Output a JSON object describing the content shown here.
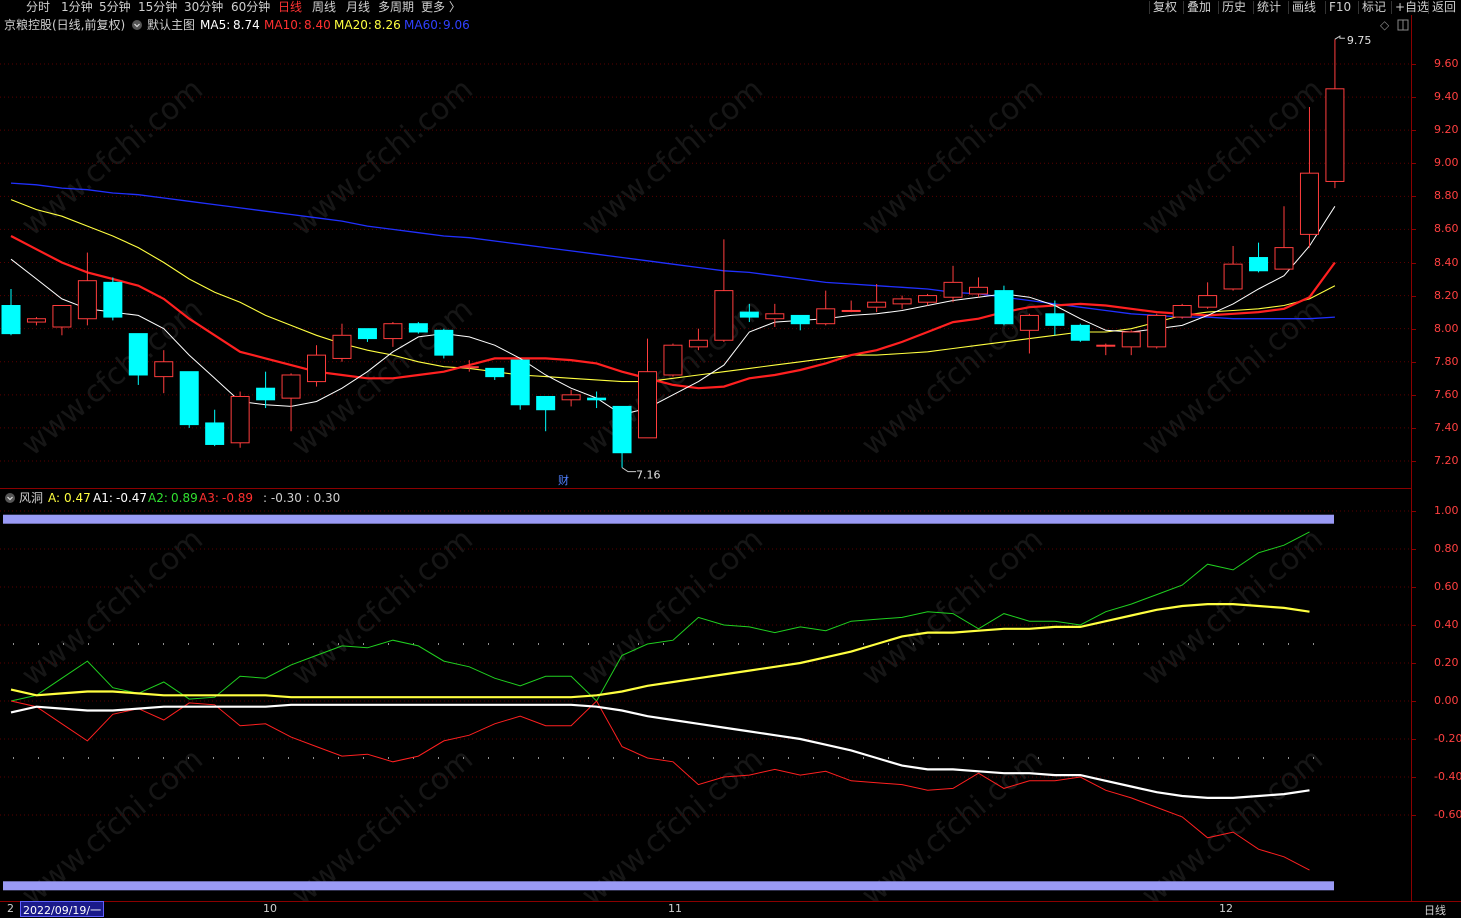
{
  "periods": [
    "分时",
    "1分钟",
    "5分钟",
    "15分钟",
    "30分钟",
    "60分钟",
    "日线",
    "周线",
    "月线",
    "多周期",
    "更多 〉"
  ],
  "active_period": "日线",
  "right_buttons": [
    "复权",
    "叠加",
    "历史",
    "统计",
    "画线",
    "F10",
    "标记",
    "+自选",
    "返回"
  ],
  "info": {
    "stock": "京粮控股(日线,前复权)",
    "theme": "默认主图",
    "ma5_label": "MA5:",
    "ma5": "8.74",
    "ma10_label": "MA10:",
    "ma10": "8.40",
    "ma20_label": "MA20:",
    "ma20": "8.26",
    "ma60_label": "MA60:",
    "ma60": "9.06"
  },
  "annotations": {
    "high": "9.75",
    "low": "7.16",
    "event": "财"
  },
  "indicator": {
    "name": "风洞",
    "a_label": "A:",
    "a": "0.47",
    "a1_label": "A1:",
    "a1": "-0.47",
    "a2_label": "A2:",
    "a2": "0.89",
    "a3_label": "A3:",
    "a3": "-0.89",
    "extra": ": -0.30 : 0.30"
  },
  "bottom": {
    "date": "2022/09/19/一",
    "m10": "10",
    "m11": "11",
    "m12": "12",
    "period": "日线",
    "edge": "2"
  },
  "watermark": "www.cfchi.com",
  "colors": {
    "up": "#ff3d3d",
    "down": "#00ffff",
    "ma5": "#ffffff",
    "ma10": "#ff2020",
    "ma20": "#ffff40",
    "ma60": "#2030ff",
    "a2": "#20d020",
    "a3": "#ff2020",
    "a": "#ffff40",
    "a1": "#ffffff"
  },
  "chart_data": [
    {
      "type": "candlestick",
      "title": "京粮控股(日线,前复权)",
      "y_ticks": [
        "9.60",
        "9.40",
        "9.20",
        "9.00",
        "8.80",
        "8.60",
        "8.40",
        "8.20",
        "8.00",
        "7.80",
        "7.60",
        "7.40",
        "7.20"
      ],
      "ylim": [
        7.1,
        9.8
      ],
      "candles": [
        {
          "o": 8.14,
          "h": 8.24,
          "l": 7.96,
          "c": 7.97
        },
        {
          "o": 8.04,
          "h": 8.07,
          "l": 8.02,
          "c": 8.06
        },
        {
          "o": 8.01,
          "h": 8.12,
          "l": 7.96,
          "c": 8.14
        },
        {
          "o": 8.06,
          "h": 8.46,
          "l": 8.02,
          "c": 8.29
        },
        {
          "o": 8.28,
          "h": 8.31,
          "l": 8.05,
          "c": 8.07
        },
        {
          "o": 7.97,
          "h": 7.97,
          "l": 7.66,
          "c": 7.72
        },
        {
          "o": 7.71,
          "h": 7.87,
          "l": 7.61,
          "c": 7.8
        },
        {
          "o": 7.74,
          "h": 7.74,
          "l": 7.4,
          "c": 7.42
        },
        {
          "o": 7.43,
          "h": 7.51,
          "l": 7.29,
          "c": 7.3
        },
        {
          "o": 7.31,
          "h": 7.62,
          "l": 7.28,
          "c": 7.59
        },
        {
          "o": 7.64,
          "h": 7.74,
          "l": 7.52,
          "c": 7.57
        },
        {
          "o": 7.58,
          "h": 7.73,
          "l": 7.38,
          "c": 7.72
        },
        {
          "o": 7.68,
          "h": 7.9,
          "l": 7.65,
          "c": 7.84
        },
        {
          "o": 7.82,
          "h": 8.03,
          "l": 7.8,
          "c": 7.96
        },
        {
          "o": 8.0,
          "h": 8.0,
          "l": 7.92,
          "c": 7.94
        },
        {
          "o": 7.94,
          "h": 8.04,
          "l": 7.89,
          "c": 8.03
        },
        {
          "o": 8.03,
          "h": 8.04,
          "l": 7.97,
          "c": 7.98
        },
        {
          "o": 7.99,
          "h": 8.0,
          "l": 7.82,
          "c": 7.84
        },
        {
          "o": 7.77,
          "h": 7.81,
          "l": 7.74,
          "c": 7.77
        },
        {
          "o": 7.76,
          "h": 7.76,
          "l": 7.69,
          "c": 7.71
        },
        {
          "o": 7.81,
          "h": 7.81,
          "l": 7.51,
          "c": 7.54
        },
        {
          "o": 7.59,
          "h": 7.59,
          "l": 7.38,
          "c": 7.51
        },
        {
          "o": 7.57,
          "h": 7.63,
          "l": 7.53,
          "c": 7.6
        },
        {
          "o": 7.58,
          "h": 7.62,
          "l": 7.52,
          "c": 7.57
        },
        {
          "o": 7.53,
          "h": 7.53,
          "l": 7.16,
          "c": 7.25
        },
        {
          "o": 7.34,
          "h": 7.94,
          "l": 7.34,
          "c": 7.74
        },
        {
          "o": 7.72,
          "h": 7.91,
          "l": 7.71,
          "c": 7.9
        },
        {
          "o": 7.89,
          "h": 8.0,
          "l": 7.87,
          "c": 7.93
        },
        {
          "o": 7.93,
          "h": 8.54,
          "l": 7.92,
          "c": 8.23
        },
        {
          "o": 8.1,
          "h": 8.15,
          "l": 8.04,
          "c": 8.07
        },
        {
          "o": 8.06,
          "h": 8.15,
          "l": 8.01,
          "c": 8.09
        },
        {
          "o": 8.08,
          "h": 8.08,
          "l": 7.99,
          "c": 8.03
        },
        {
          "o": 8.03,
          "h": 8.23,
          "l": 8.02,
          "c": 8.12
        },
        {
          "o": 8.11,
          "h": 8.17,
          "l": 8.1,
          "c": 8.11
        },
        {
          "o": 8.13,
          "h": 8.27,
          "l": 8.1,
          "c": 8.16
        },
        {
          "o": 8.15,
          "h": 8.2,
          "l": 8.12,
          "c": 8.18
        },
        {
          "o": 8.16,
          "h": 8.21,
          "l": 8.14,
          "c": 8.2
        },
        {
          "o": 8.19,
          "h": 8.38,
          "l": 8.16,
          "c": 8.28
        },
        {
          "o": 8.21,
          "h": 8.31,
          "l": 8.19,
          "c": 8.25
        },
        {
          "o": 8.23,
          "h": 8.26,
          "l": 8.02,
          "c": 8.03
        },
        {
          "o": 7.99,
          "h": 8.09,
          "l": 7.85,
          "c": 8.08
        },
        {
          "o": 8.09,
          "h": 8.17,
          "l": 7.96,
          "c": 8.02
        },
        {
          "o": 8.02,
          "h": 8.03,
          "l": 7.92,
          "c": 7.93
        },
        {
          "o": 7.9,
          "h": 7.91,
          "l": 7.84,
          "c": 7.9
        },
        {
          "o": 7.89,
          "h": 7.99,
          "l": 7.84,
          "c": 7.98
        },
        {
          "o": 7.89,
          "h": 8.09,
          "l": 7.88,
          "c": 8.08
        },
        {
          "o": 8.07,
          "h": 8.15,
          "l": 8.06,
          "c": 8.14
        },
        {
          "o": 8.13,
          "h": 8.28,
          "l": 8.12,
          "c": 8.2
        },
        {
          "o": 8.24,
          "h": 8.5,
          "l": 8.23,
          "c": 8.39
        },
        {
          "o": 8.43,
          "h": 8.52,
          "l": 8.34,
          "c": 8.35
        },
        {
          "o": 8.36,
          "h": 8.74,
          "l": 8.36,
          "c": 8.49
        },
        {
          "o": 8.57,
          "h": 9.34,
          "l": 8.49,
          "c": 8.94
        },
        {
          "o": 8.89,
          "h": 9.75,
          "l": 8.85,
          "c": 9.45
        }
      ],
      "ma5": [
        8.42,
        8.3,
        8.18,
        8.12,
        8.1,
        8.08,
        8.0,
        7.84,
        7.7,
        7.56,
        7.54,
        7.53,
        7.56,
        7.64,
        7.74,
        7.86,
        7.95,
        7.97,
        7.95,
        7.9,
        7.82,
        7.72,
        7.64,
        7.58,
        7.48,
        7.52,
        7.6,
        7.68,
        7.78,
        7.98,
        8.04,
        8.05,
        8.06,
        8.08,
        8.09,
        8.11,
        8.14,
        8.17,
        8.19,
        8.21,
        8.19,
        8.14,
        8.06,
        7.99,
        7.98,
        8.0,
        8.02,
        8.08,
        8.15,
        8.24,
        8.32,
        8.5,
        8.74
      ],
      "ma10": [
        8.56,
        8.48,
        8.4,
        8.34,
        8.3,
        8.26,
        8.18,
        8.06,
        7.96,
        7.86,
        7.82,
        7.78,
        7.74,
        7.72,
        7.7,
        7.7,
        7.72,
        7.74,
        7.78,
        7.82,
        7.82,
        7.82,
        7.81,
        7.79,
        7.74,
        7.7,
        7.66,
        7.64,
        7.65,
        7.7,
        7.72,
        7.75,
        7.79,
        7.84,
        7.87,
        7.92,
        7.98,
        8.04,
        8.06,
        8.1,
        8.13,
        8.14,
        8.15,
        8.14,
        8.12,
        8.1,
        8.09,
        8.08,
        8.09,
        8.1,
        8.12,
        8.19,
        8.4
      ],
      "ma20": [
        8.78,
        8.72,
        8.68,
        8.62,
        8.56,
        8.49,
        8.4,
        8.3,
        8.22,
        8.16,
        8.08,
        8.02,
        7.96,
        7.91,
        7.87,
        7.84,
        7.8,
        7.77,
        7.76,
        7.74,
        7.72,
        7.71,
        7.7,
        7.69,
        7.68,
        7.68,
        7.7,
        7.72,
        7.74,
        7.76,
        7.78,
        7.8,
        7.82,
        7.84,
        7.84,
        7.85,
        7.86,
        7.88,
        7.9,
        7.92,
        7.94,
        7.96,
        7.98,
        7.98,
        8.0,
        8.04,
        8.08,
        8.1,
        8.11,
        8.12,
        8.14,
        8.18,
        8.26
      ],
      "ma60": [
        8.88,
        8.87,
        8.85,
        8.84,
        8.82,
        8.81,
        8.79,
        8.77,
        8.75,
        8.73,
        8.71,
        8.69,
        8.67,
        8.65,
        8.62,
        8.6,
        8.58,
        8.56,
        8.55,
        8.53,
        8.51,
        8.49,
        8.47,
        8.45,
        8.43,
        8.41,
        8.39,
        8.37,
        8.35,
        8.34,
        8.32,
        8.3,
        8.28,
        8.27,
        8.26,
        8.25,
        8.24,
        8.22,
        8.21,
        8.19,
        8.17,
        8.15,
        8.13,
        8.11,
        8.09,
        8.08,
        8.07,
        8.07,
        8.06,
        8.06,
        8.06,
        8.06,
        8.07
      ]
    },
    {
      "type": "line",
      "title": "风洞",
      "y_ticks": [
        "1.00",
        "0.80",
        "0.60",
        "0.40",
        "0.20",
        "0.00",
        "-0.20",
        "-0.40",
        "-0.60"
      ],
      "ylim": [
        -1.0,
        1.05
      ],
      "band_upper": 0.97,
      "band_lower": -0.97,
      "dotted_levels": [
        0.3,
        -0.3
      ],
      "series": [
        {
          "name": "A2",
          "values": [
            0.0,
            0.03,
            0.12,
            0.21,
            0.07,
            0.04,
            0.1,
            0.01,
            0.02,
            0.13,
            0.12,
            0.19,
            0.24,
            0.29,
            0.28,
            0.32,
            0.29,
            0.21,
            0.18,
            0.12,
            0.08,
            0.13,
            0.13,
            0.0,
            0.24,
            0.3,
            0.32,
            0.44,
            0.4,
            0.39,
            0.36,
            0.39,
            0.37,
            0.42,
            0.43,
            0.44,
            0.47,
            0.46,
            0.38,
            0.46,
            0.42,
            0.42,
            0.4,
            0.47,
            0.51,
            0.56,
            0.61,
            0.72,
            0.69,
            0.78,
            0.82,
            0.89
          ]
        },
        {
          "name": "A3",
          "values": [
            0.0,
            -0.03,
            -0.12,
            -0.21,
            -0.07,
            -0.04,
            -0.1,
            -0.01,
            -0.02,
            -0.13,
            -0.12,
            -0.19,
            -0.24,
            -0.29,
            -0.28,
            -0.32,
            -0.29,
            -0.21,
            -0.18,
            -0.12,
            -0.08,
            -0.13,
            -0.13,
            0.0,
            -0.24,
            -0.3,
            -0.32,
            -0.44,
            -0.4,
            -0.39,
            -0.36,
            -0.39,
            -0.37,
            -0.42,
            -0.43,
            -0.44,
            -0.47,
            -0.46,
            -0.38,
            -0.46,
            -0.42,
            -0.42,
            -0.4,
            -0.47,
            -0.51,
            -0.56,
            -0.61,
            -0.72,
            -0.69,
            -0.78,
            -0.82,
            -0.89
          ]
        },
        {
          "name": "A",
          "values": [
            0.06,
            0.03,
            0.04,
            0.05,
            0.05,
            0.04,
            0.03,
            0.03,
            0.03,
            0.03,
            0.03,
            0.02,
            0.02,
            0.02,
            0.02,
            0.02,
            0.02,
            0.02,
            0.02,
            0.02,
            0.02,
            0.02,
            0.02,
            0.03,
            0.05,
            0.08,
            0.1,
            0.12,
            0.14,
            0.16,
            0.18,
            0.2,
            0.23,
            0.26,
            0.3,
            0.34,
            0.36,
            0.36,
            0.37,
            0.38,
            0.38,
            0.39,
            0.39,
            0.42,
            0.45,
            0.48,
            0.5,
            0.51,
            0.51,
            0.5,
            0.49,
            0.47
          ]
        },
        {
          "name": "A1",
          "values": [
            -0.06,
            -0.03,
            -0.04,
            -0.05,
            -0.05,
            -0.04,
            -0.03,
            -0.03,
            -0.03,
            -0.03,
            -0.03,
            -0.02,
            -0.02,
            -0.02,
            -0.02,
            -0.02,
            -0.02,
            -0.02,
            -0.02,
            -0.02,
            -0.02,
            -0.02,
            -0.02,
            -0.03,
            -0.05,
            -0.08,
            -0.1,
            -0.12,
            -0.14,
            -0.16,
            -0.18,
            -0.2,
            -0.23,
            -0.26,
            -0.3,
            -0.34,
            -0.36,
            -0.36,
            -0.37,
            -0.38,
            -0.38,
            -0.39,
            -0.39,
            -0.42,
            -0.45,
            -0.48,
            -0.5,
            -0.51,
            -0.51,
            -0.5,
            -0.49,
            -0.47
          ]
        }
      ]
    }
  ]
}
